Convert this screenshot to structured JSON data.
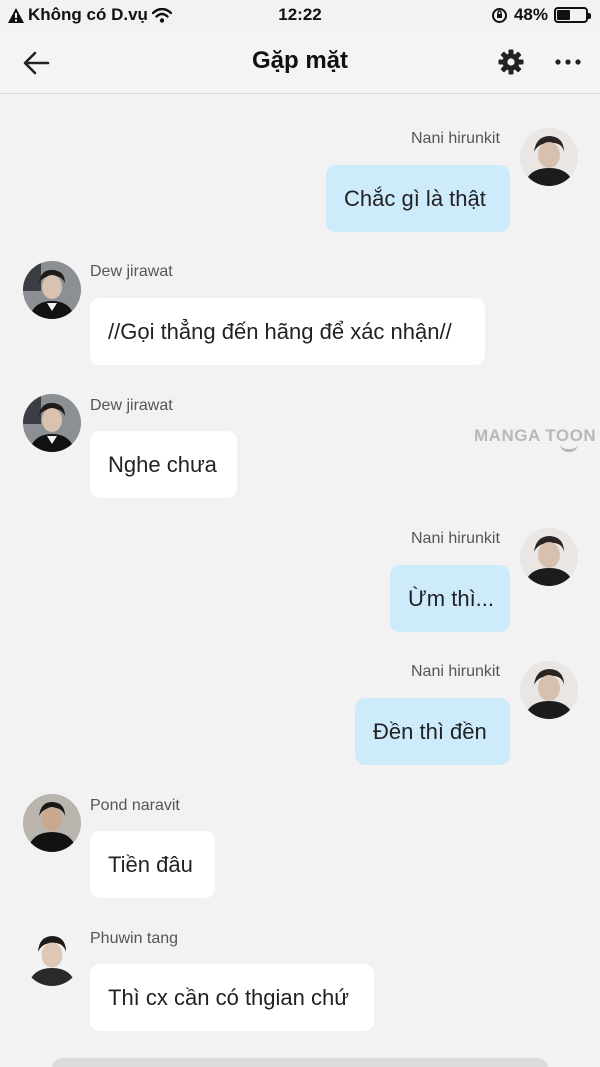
{
  "status_bar": {
    "carrier": "Không có D.vụ",
    "time": "12:22",
    "battery_percent": "48%",
    "battery_level": 0.48
  },
  "nav": {
    "title": "Gặp mặt",
    "back_icon": "arrow-left-icon",
    "settings_icon": "gear-icon",
    "more_icon": "more-dots-icon"
  },
  "watermark": "MANGA TOON",
  "colors": {
    "outgoing_bubble": "#cdebfb",
    "incoming_bubble": "#ffffff",
    "background": "#f2f2f2"
  },
  "messages": [
    {
      "sender": "Nani hirunkit",
      "text": "Chắc gì là thật",
      "direction": "outgoing"
    },
    {
      "sender": "Dew jirawat",
      "text": "//Gọi thẳng đến hãng để xác nhận//",
      "direction": "incoming"
    },
    {
      "sender": "Dew jirawat",
      "text": "Nghe chưa",
      "direction": "incoming"
    },
    {
      "sender": "Nani hirunkit",
      "text": "Ừm thì...",
      "direction": "outgoing"
    },
    {
      "sender": "Nani hirunkit",
      "text": "Đền thì đền",
      "direction": "outgoing"
    },
    {
      "sender": "Pond naravit",
      "text": "Tiền đâu",
      "direction": "incoming"
    },
    {
      "sender": "Phuwin tang",
      "text": "Thì cx cần có thgian chứ",
      "direction": "incoming"
    }
  ]
}
